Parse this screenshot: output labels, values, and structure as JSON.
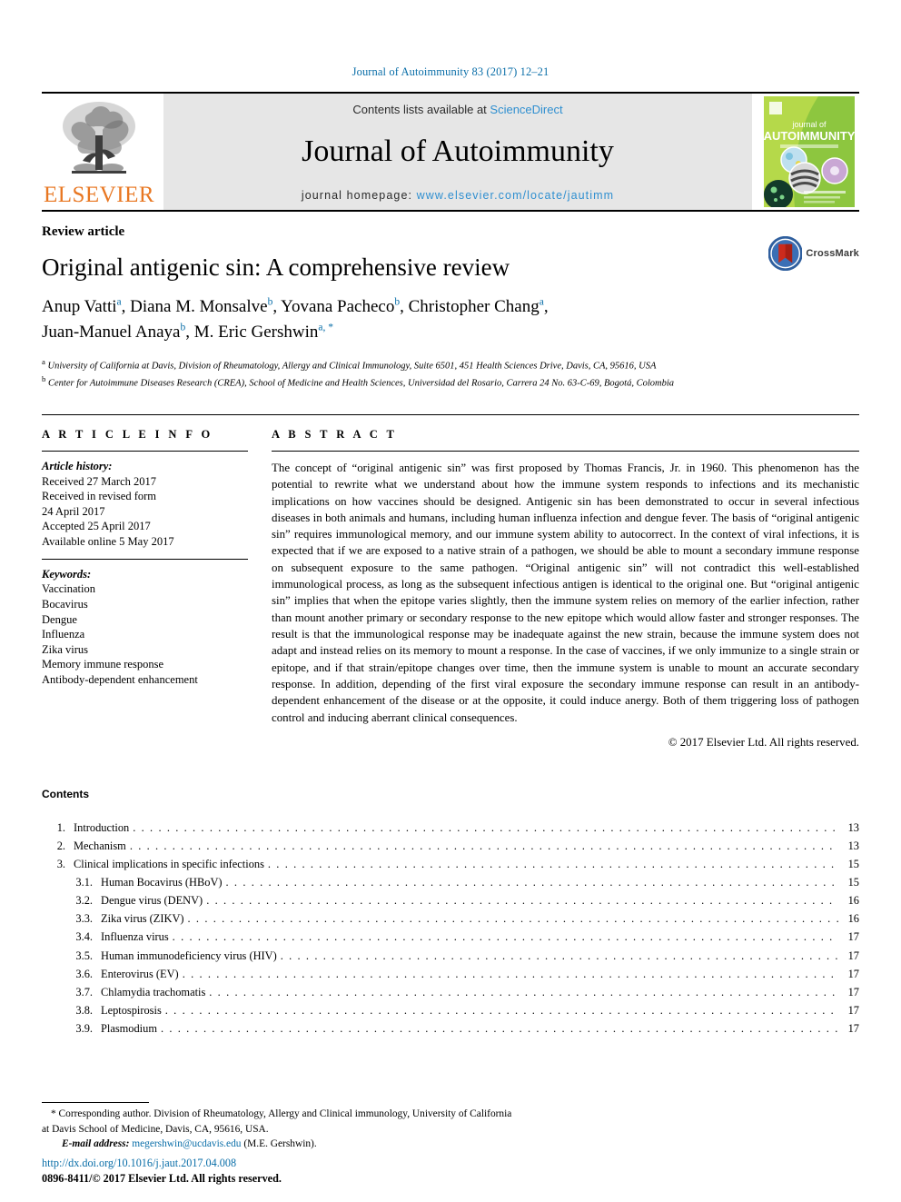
{
  "running_head": "Journal of Autoimmunity 83 (2017) 12–21",
  "masthead": {
    "publisher_name": "ELSEVIER",
    "contents_prefix": "Contents lists available at ",
    "contents_link": "ScienceDirect",
    "journal_name": "Journal of Autoimmunity",
    "homepage_prefix": "journal homepage: ",
    "homepage_url": "www.elsevier.com/locate/jautimm",
    "cover": {
      "line1": "journal of",
      "line2": "AUTOIMMUNITY"
    }
  },
  "article": {
    "type": "Review article",
    "title": "Original antigenic sin: A comprehensive review",
    "authors_line1": "Anup Vatti ",
    "authors": [
      {
        "name": "Anup Vatti",
        "marks": "a"
      },
      {
        "name": "Diana M. Monsalve",
        "marks": "b"
      },
      {
        "name": "Yovana Pacheco",
        "marks": "b"
      },
      {
        "name": "Christopher Chang",
        "marks": "a"
      },
      {
        "name": "Juan-Manuel Anaya",
        "marks": "b"
      },
      {
        "name": "M. Eric Gershwin",
        "marks": "a, *"
      }
    ],
    "affiliations": [
      {
        "mark": "a",
        "text": "University of California at Davis, Division of Rheumatology, Allergy and Clinical Immunology, Suite 6501, 451 Health Sciences Drive, Davis, CA, 95616, USA"
      },
      {
        "mark": "b",
        "text": "Center for Autoimmune Diseases Research (CREA), School of Medicine and Health Sciences, Universidad del Rosario, Carrera 24 No. 63-C-69, Bogotá, Colombia"
      }
    ],
    "crossmark_label": "CrossMark"
  },
  "article_info": {
    "heading": "A R T I C L E   I N F O",
    "history_label": "Article history:",
    "history": [
      "Received 27 March 2017",
      "Received in revised form",
      "24 April 2017",
      "Accepted 25 April 2017",
      "Available online 5 May 2017"
    ],
    "keywords_label": "Keywords:",
    "keywords": [
      "Vaccination",
      "Bocavirus",
      "Dengue",
      "Influenza",
      "Zika virus",
      "Memory immune response",
      "Antibody-dependent enhancement"
    ]
  },
  "abstract": {
    "heading": "A B S T R A C T",
    "text": "The concept of “original antigenic sin” was first proposed by Thomas Francis, Jr. in 1960. This phenomenon has the potential to rewrite what we understand about how the immune system responds to infections and its mechanistic implications on how vaccines should be designed. Antigenic sin has been demonstrated to occur in several infectious diseases in both animals and humans, including human influenza infection and dengue fever. The basis of “original antigenic sin” requires immunological memory, and our immune system ability to autocorrect. In the context of viral infections, it is expected that if we are exposed to a native strain of a pathogen, we should be able to mount a secondary immune response on subsequent exposure to the same pathogen. “Original antigenic sin” will not contradict this well-established immunological process, as long as the subsequent infectious antigen is identical to the original one. But “original antigenic sin” implies that when the epitope varies slightly, then the immune system relies on memory of the earlier infection, rather than mount another primary or secondary response to the new epitope which would allow faster and stronger responses. The result is that the immunological response may be inadequate against the new strain, because the immune system does not adapt and instead relies on its memory to mount a response. In the case of vaccines, if we only immunize to a single strain or epitope, and if that strain/epitope changes over time, then the immune system is unable to mount an accurate secondary response. In addition, depending of the first viral exposure the secondary immune response can result in an antibody-dependent enhancement of the disease or at the opposite, it could induce anergy. Both of them triggering loss of pathogen control and inducing aberrant clinical consequences.",
    "copyright": "© 2017 Elsevier Ltd. All rights reserved."
  },
  "contents": {
    "title": "Contents",
    "entries": [
      {
        "num": "1.",
        "label": "Introduction",
        "page": "13",
        "sub": false
      },
      {
        "num": "2.",
        "label": "Mechanism",
        "page": "13",
        "sub": false
      },
      {
        "num": "3.",
        "label": "Clinical implications in specific infections",
        "page": "15",
        "sub": false
      },
      {
        "num": "3.1.",
        "label": "Human Bocavirus (HBoV)",
        "page": "15",
        "sub": true
      },
      {
        "num": "3.2.",
        "label": "Dengue virus (DENV)",
        "page": "16",
        "sub": true
      },
      {
        "num": "3.3.",
        "label": "Zika virus (ZIKV)",
        "page": "16",
        "sub": true
      },
      {
        "num": "3.4.",
        "label": "Influenza virus",
        "page": "17",
        "sub": true
      },
      {
        "num": "3.5.",
        "label": "Human immunodeficiency virus (HIV)",
        "page": "17",
        "sub": true
      },
      {
        "num": "3.6.",
        "label": "Enterovirus (EV)",
        "page": "17",
        "sub": true
      },
      {
        "num": "3.7.",
        "label": "Chlamydia trachomatis",
        "page": "17",
        "sub": true
      },
      {
        "num": "3.8.",
        "label": "Leptospirosis",
        "page": "17",
        "sub": true
      },
      {
        "num": "3.9.",
        "label": "Plasmodium",
        "page": "17",
        "sub": true
      }
    ]
  },
  "footer": {
    "corresponding_note": "* Corresponding author. Division of Rheumatology, Allergy and Clinical immunology, University of California at Davis School of Medicine, Davis, CA, 95616, USA.",
    "email_label": "E-mail address:",
    "email": "megershwin@ucdavis.edu",
    "email_suffix": "(M.E. Gershwin).",
    "doi": "http://dx.doi.org/10.1016/j.jaut.2017.04.008",
    "issn_line": "0896-8411/© 2017 Elsevier Ltd. All rights reserved."
  },
  "colors": {
    "link_blue": "#0a6ea8",
    "sciencedirect_blue": "#2f8fd0",
    "elsevier_orange": "#E87722",
    "cover_green": "#7bbd2a",
    "masthead_grey": "#e6e6e6"
  }
}
